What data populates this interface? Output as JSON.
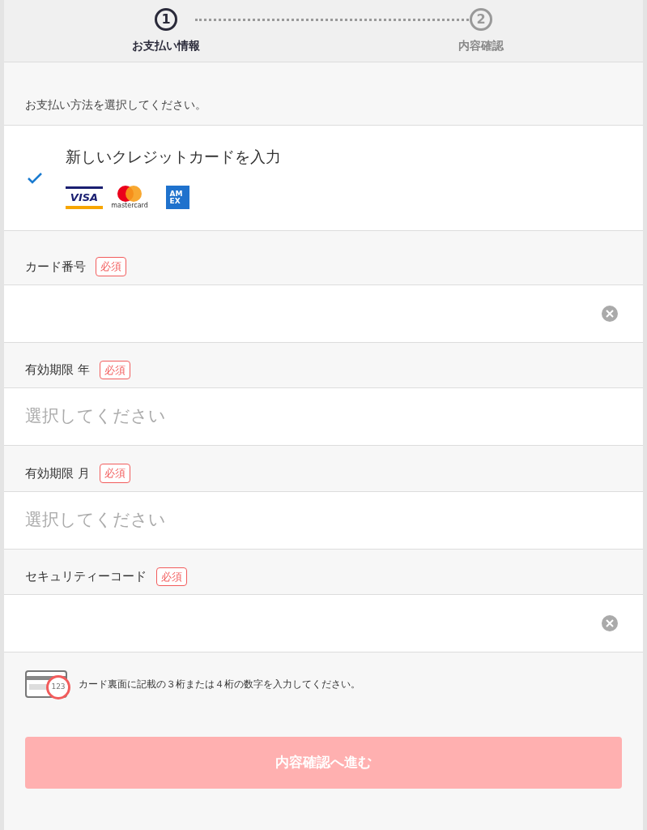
{
  "steps": [
    {
      "number": "1",
      "label": "お支払い情報",
      "selected": true
    },
    {
      "number": "2",
      "label": "内容確認",
      "selected": false
    }
  ],
  "intro": "お支払い方法を選択してください。",
  "payment_option": {
    "label": "新しいクレジットカードを入力",
    "checked": true,
    "brands": [
      {
        "kind": "visa",
        "label": "VISA"
      },
      {
        "kind": "mastercard",
        "label": "mastercard"
      },
      {
        "kind": "amex",
        "label": "AM EX"
      }
    ]
  },
  "fields": [
    {
      "kind": "text",
      "label": "カード番号",
      "required": "必須",
      "clearable": true
    },
    {
      "kind": "select",
      "label": "有効期限 年",
      "required": "必須",
      "placeholder": "選択してください"
    },
    {
      "kind": "select",
      "label": "有効期限 月",
      "required": "必須",
      "placeholder": "選択してください"
    },
    {
      "kind": "text",
      "label": "セキュリティーコード",
      "required": "必須",
      "clearable": true
    }
  ],
  "hint": {
    "card_digits": "123",
    "text": "カード裏面に記載の３桁または４桁の数字を入力してください。"
  },
  "submit": {
    "label": "内容確認へ進む",
    "disabled": true
  }
}
